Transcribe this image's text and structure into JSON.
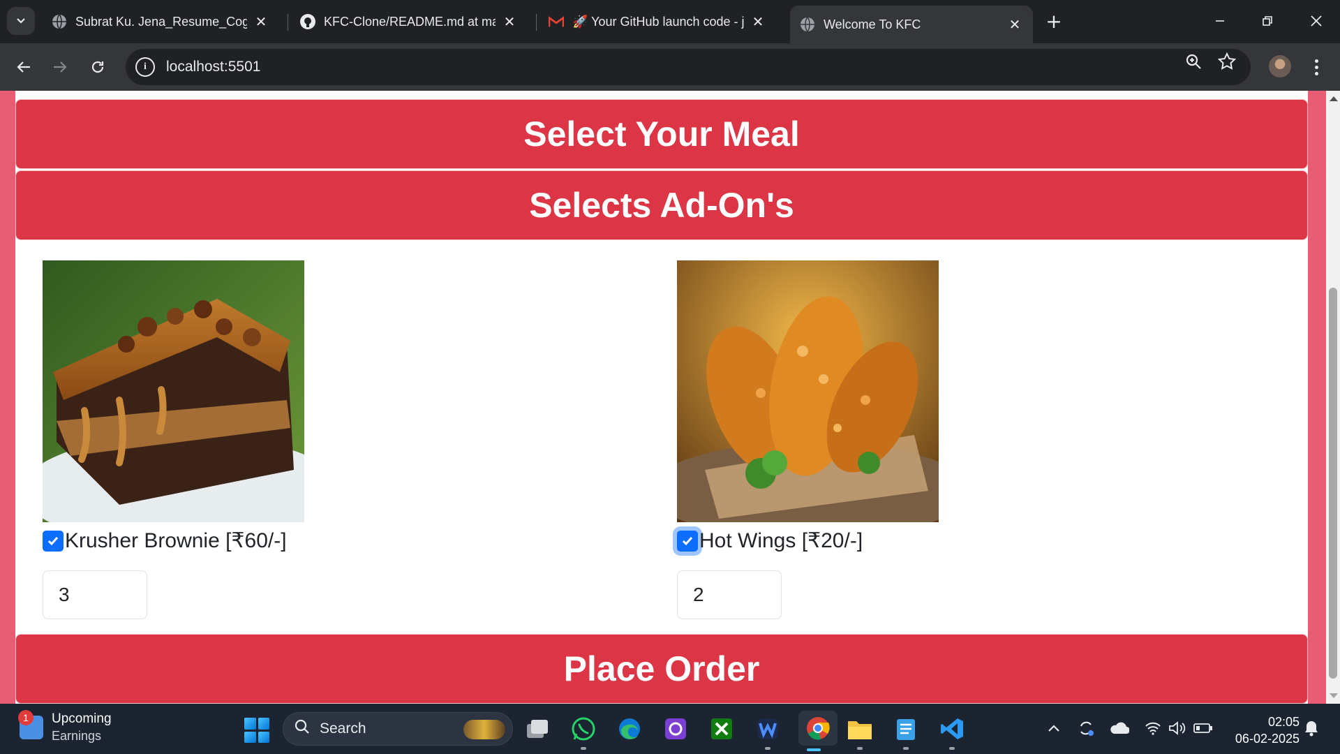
{
  "browser": {
    "tabs": [
      {
        "title": "Subrat Ku. Jena_Resume_Cog.pdf",
        "active": false,
        "favicon": "globe-icon"
      },
      {
        "title": "KFC-Clone/README.md at main",
        "active": false,
        "favicon": "github-icon"
      },
      {
        "title": "🚀 Your GitHub launch code - j",
        "active": false,
        "favicon": "gmail-icon"
      },
      {
        "title": "Welcome To KFC",
        "active": true,
        "favicon": "globe-icon"
      }
    ],
    "url": "localhost:5501"
  },
  "page": {
    "select_meal_title": "Select Your Meal",
    "addons_title": "Selects Ad-On's",
    "addons": [
      {
        "label": "Krusher Brownie [₹60/-]",
        "checked": true,
        "quantity": "3",
        "image": "brownie-photo"
      },
      {
        "label": "Hot Wings [₹20/-]",
        "checked": true,
        "quantity": "2",
        "image": "hot-wings-photo"
      }
    ],
    "place_order_label": "Place Order",
    "colors": {
      "accent": "#dc3545",
      "page_bg": "#e85c74",
      "checkbox": "#0d6efd"
    }
  },
  "taskbar": {
    "widget_badge": "1",
    "widget_line1": "Upcoming",
    "widget_line2": "Earnings",
    "search_label": "Search",
    "time": "02:05",
    "date": "06-02-2025"
  }
}
